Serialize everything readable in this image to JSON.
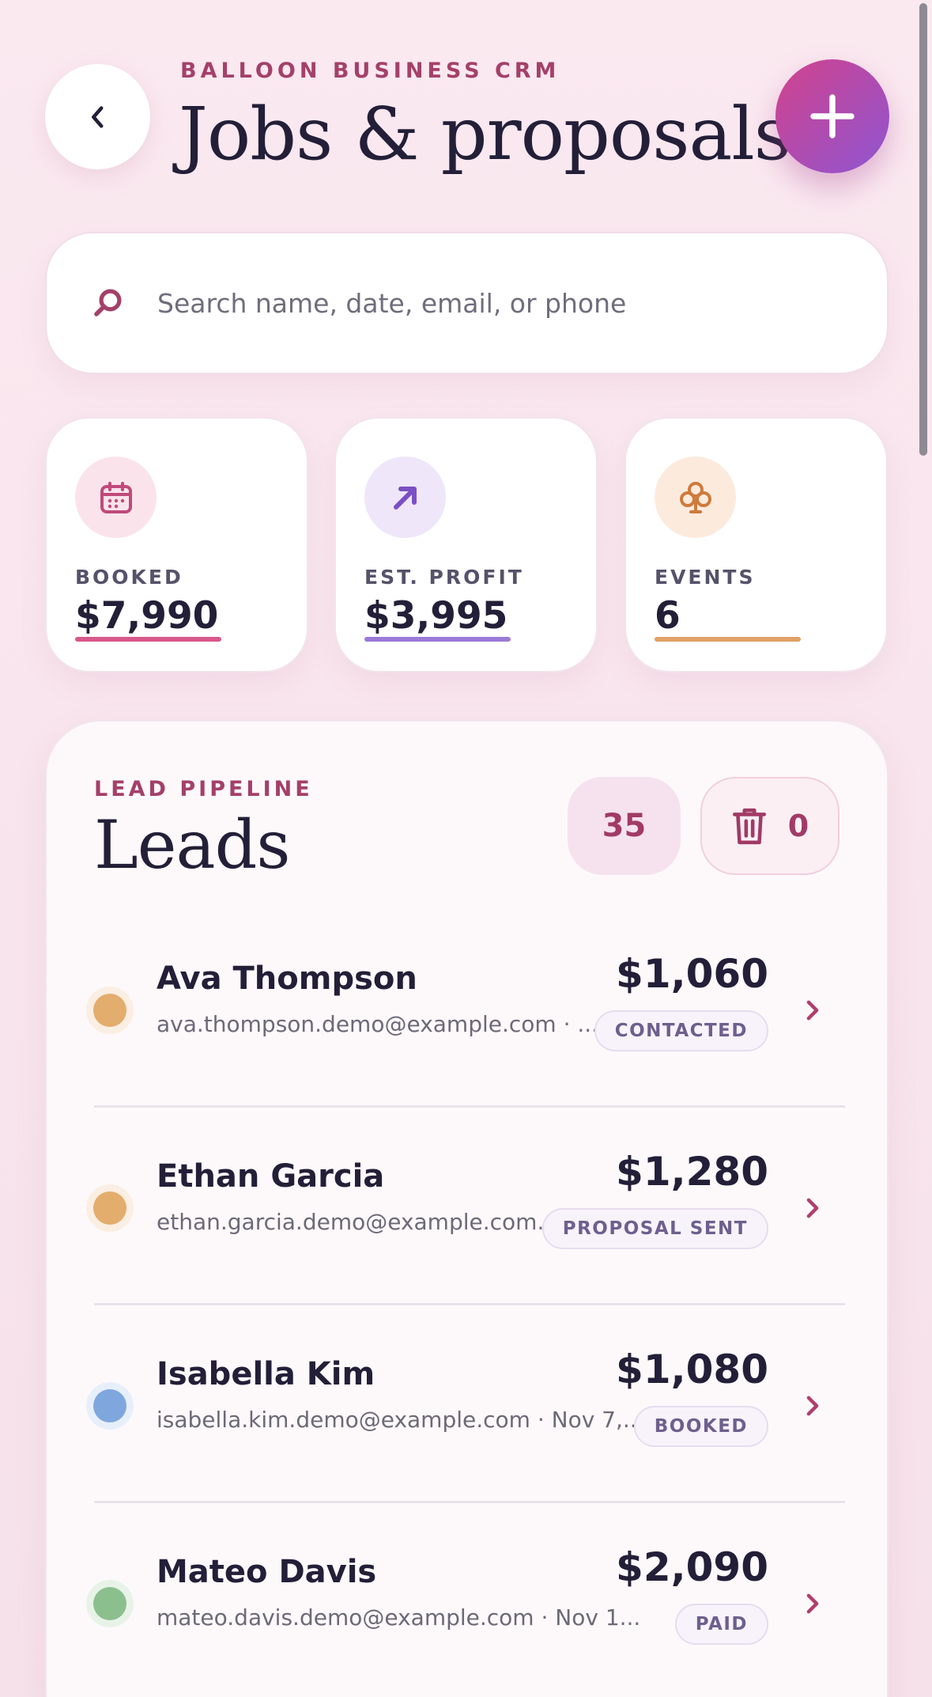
{
  "header": {
    "kicker": "BALLOON BUSINESS CRM",
    "title": "Jobs & proposals"
  },
  "search": {
    "placeholder": "Search name, date, email, or phone"
  },
  "stats": [
    {
      "label": "BOOKED",
      "value": "$7,990",
      "icon": "calendar-icon",
      "accent": "#d8588a"
    },
    {
      "label": "EST. PROFIT",
      "value": "$3,995",
      "icon": "arrow-up-right-icon",
      "accent": "#9b7ad8"
    },
    {
      "label": "EVENTS",
      "value": "6",
      "icon": "balloon-cluster-icon",
      "accent": "#e2a065"
    }
  ],
  "leads": {
    "kicker": "LEAD PIPELINE",
    "title": "Leads",
    "count": "35",
    "trash_count": "0",
    "items": [
      {
        "name": "Ava Thompson",
        "meta": "ava.thompson.demo@example.com · ...",
        "amount": "$1,060",
        "status": "CONTACTED",
        "dot_color": "#e3ad6d"
      },
      {
        "name": "Ethan Garcia",
        "meta": "ethan.garcia.demo@example.com...",
        "amount": "$1,280",
        "status": "PROPOSAL SENT",
        "dot_color": "#e3ad6d"
      },
      {
        "name": "Isabella Kim",
        "meta": "isabella.kim.demo@example.com · Nov 7,...",
        "amount": "$1,080",
        "status": "BOOKED",
        "dot_color": "#7fa7dd"
      },
      {
        "name": "Mateo Davis",
        "meta": "mateo.davis.demo@example.com · Nov 1...",
        "amount": "$2,090",
        "status": "PAID",
        "dot_color": "#8cbf8e"
      }
    ]
  },
  "colors": {
    "brand": "#a4406a",
    "fab_gradient_start": "#d2428c",
    "fab_gradient_end": "#8e55d2"
  }
}
